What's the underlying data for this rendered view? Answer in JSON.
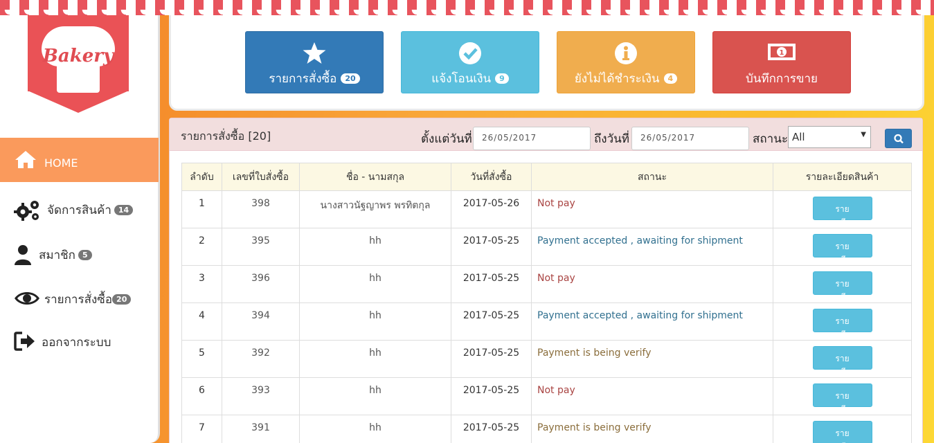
{
  "brand": {
    "logo_text": "Bakery",
    "accent": "#ea5256"
  },
  "sidebar": {
    "items": [
      {
        "label": "HOME",
        "icon": "home-icon",
        "badge": ""
      },
      {
        "label": "จัดการสินค้า",
        "icon": "gears-icon",
        "badge": "14"
      },
      {
        "label": "สมาชิก",
        "icon": "user-icon",
        "badge": "5"
      },
      {
        "label": "รายการสั่งซื้อ",
        "icon": "eye-icon",
        "badge": "20"
      },
      {
        "label": "ออกจากระบบ",
        "icon": "sign-out-icon",
        "badge": ""
      }
    ]
  },
  "tiles": [
    {
      "label": "รายการสั่งซื้อ",
      "badge": "20",
      "icon": "star-icon",
      "color": "#337ab7"
    },
    {
      "label": "แจ้งโอนเงิน",
      "badge": "9",
      "icon": "check-circle-icon",
      "color": "#5bc0de"
    },
    {
      "label": "ยังไม่ได้ชำระเงิน",
      "badge": "4",
      "icon": "info-circle-icon",
      "color": "#f0ad4e"
    },
    {
      "label": "บันทึกการขาย",
      "badge": "",
      "icon": "money-icon",
      "color": "#d9534f"
    }
  ],
  "orders": {
    "title": "รายการสั่งซื้อ [20]",
    "filter": {
      "from_label": "ตั้งแต่วันที่",
      "from_value": "26/05/2017",
      "to_label": "ถึงวันที่",
      "to_value": "26/05/2017",
      "status_label": "สถานะ",
      "status_value": "All"
    },
    "columns": [
      "ลำดับ",
      "เลขที่ใบสั่งซื้อ",
      "ชื่อ - นามสกุล",
      "วันที่สั่งซื้อ",
      "สถานะ",
      "รายละเอียดสินค้า"
    ],
    "detail_button": "รายละเอียด",
    "rows": [
      {
        "no": "1",
        "order_id": "398",
        "name": "นางสาวนัฐญาพร พรทิตกุล",
        "date": "2017-05-26",
        "status": "Not pay",
        "tone": "red"
      },
      {
        "no": "2",
        "order_id": "395",
        "name": "hh",
        "date": "2017-05-25",
        "status": "Payment accepted , awaiting for shipment",
        "tone": "blue"
      },
      {
        "no": "3",
        "order_id": "396",
        "name": "hh",
        "date": "2017-05-25",
        "status": "Not pay",
        "tone": "red"
      },
      {
        "no": "4",
        "order_id": "394",
        "name": "hh",
        "date": "2017-05-25",
        "status": "Payment accepted , awaiting for shipment",
        "tone": "blue"
      },
      {
        "no": "5",
        "order_id": "392",
        "name": "hh",
        "date": "2017-05-25",
        "status": "Payment is being verify",
        "tone": "brown"
      },
      {
        "no": "6",
        "order_id": "393",
        "name": "hh",
        "date": "2017-05-25",
        "status": "Not pay",
        "tone": "red"
      },
      {
        "no": "7",
        "order_id": "391",
        "name": "hh",
        "date": "2017-05-25",
        "status": "Payment is being verify",
        "tone": "brown"
      }
    ]
  }
}
